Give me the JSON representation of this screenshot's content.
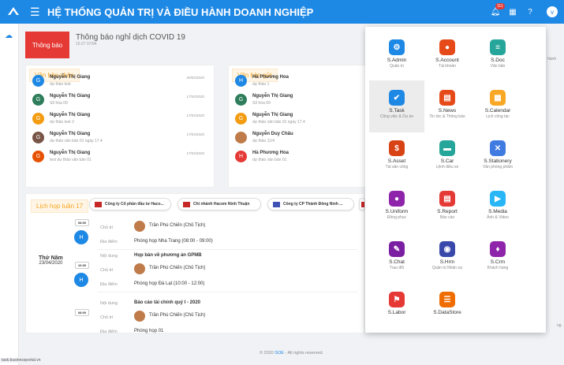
{
  "header": {
    "title": "HỆ THỐNG QUẢN TRỊ VÀ ĐIỀU HÀNH DOANH NGHIỆP",
    "notif_count": "111",
    "menu_icon": "hamburger-icon",
    "avatar_initial": "v",
    "brand_color": "#1e88e5"
  },
  "notification": {
    "label": "Thông báo",
    "title": "Thông báo nghỉ dịch COVID 19",
    "time": "16:27 07/04"
  },
  "received": {
    "title": "Văn bản nhận",
    "items": [
      {
        "initial": "G",
        "name": "Nguyễn Thị Giang",
        "sub": "dự thảo test",
        "date": "20/04/2020",
        "color": "#1e88e5"
      },
      {
        "initial": "G",
        "name": "Nguyễn Thị Giang",
        "sub": "Sổ hóa 09",
        "date": "17/04/2020",
        "color": "#2e7d5b"
      },
      {
        "initial": "G",
        "name": "Nguyễn Thị Giang",
        "sub": "dự thảo test 2",
        "date": "17/04/2020",
        "color": "#f39c12"
      },
      {
        "initial": "G",
        "name": "Nguyễn Thị Giang",
        "sub": "dự thảo văn bản 01 ngày 17.4",
        "date": "17/04/2020",
        "color": "#795548"
      },
      {
        "initial": "G",
        "name": "Nguyễn Thị Giang",
        "sub": "test dự thảo văn bản 01",
        "date": "17/04/2020",
        "color": "#e65100"
      }
    ]
  },
  "sent": {
    "title": "Văn bản gửi",
    "items": [
      {
        "initial": "H",
        "name": "Hà Phương Hoa",
        "sub": "dự thảo 1",
        "color": "#1e88e5",
        "photo": false
      },
      {
        "initial": "G",
        "name": "Nguyễn Thị Giang",
        "sub": "Sổ hóa 09",
        "color": "#2e7d5b",
        "photo": false
      },
      {
        "initial": "G",
        "name": "Nguyễn Thị Giang",
        "sub": "dự thảo văn bản 01 ngày 17.4",
        "color": "#f39c12",
        "photo": false
      },
      {
        "initial": "C",
        "name": "Nguyễn Duy Châu",
        "sub": "dự thảo 11/4",
        "color": "#bf7b4a",
        "photo": true
      },
      {
        "initial": "H",
        "name": "Hà Phương Hoa",
        "sub": "dự thảo văn bản 01",
        "color": "#e53935",
        "photo": false
      }
    ]
  },
  "calendar": {
    "title": "Lịch họp tuần 17",
    "orgs": [
      "Công ty Cổ phần đầu tư Haco...",
      "Chi nhánh Hacom Ninh Thuận",
      "Công ty CP Thành Đông Ninh ..."
    ],
    "day": "Thứ Năm",
    "date": "23/04/2020",
    "labels": {
      "content": "Nội dung",
      "chair": "Chủ trì",
      "place": "Địa điểm"
    },
    "meetings": [
      {
        "slot": "08:00",
        "initial": "H",
        "chair": "Trần Phú Chiến (Chủ Tịch)",
        "place": "Phòng họp Nha Trang (08:00 - 09:00)"
      },
      {
        "slot": "10:00",
        "initial": "H",
        "content": "Họp bàn về phương án GPMB",
        "chair": "Trần Phú Chiến (Chủ Tịch)",
        "place": "Phòng họp Đà Lạt (10:00 - 12:00)"
      },
      {
        "slot": "08:00",
        "initial": "",
        "content": "Báo cáo tài chính quý I - 2020",
        "chair": "Trần Phú Chiến (Chủ Tịch)",
        "place": "Phòng họp 01"
      }
    ]
  },
  "apps": [
    {
      "name": "S.Admin",
      "sub": "Quản trị",
      "icon": "admin-icon",
      "color": "#1e88e5",
      "glyph": "⚙"
    },
    {
      "name": "S.Account",
      "sub": "Tài khoản",
      "icon": "account-icon",
      "color": "#e64a19",
      "glyph": "●"
    },
    {
      "name": "S.Doc",
      "sub": "Văn bản",
      "icon": "doc-icon",
      "color": "#26a69a",
      "glyph": "≡"
    },
    {
      "name": "S.Task",
      "sub": "Công việc & Dự án",
      "icon": "task-icon",
      "color": "#1e88e5",
      "glyph": "✔"
    },
    {
      "name": "S.News",
      "sub": "Tin tức & Thông báo",
      "icon": "news-icon",
      "color": "#e64a19",
      "glyph": "▤"
    },
    {
      "name": "S.Calendar",
      "sub": "Lịch công tác",
      "icon": "calendar-icon",
      "color": "#f9a825",
      "glyph": "▦"
    },
    {
      "name": "S.Asset",
      "sub": "Tài sản công",
      "icon": "asset-icon",
      "color": "#d84315",
      "glyph": "$"
    },
    {
      "name": "S.Car",
      "sub": "Lệnh điều xe",
      "icon": "car-icon",
      "color": "#26a69a",
      "glyph": "▬"
    },
    {
      "name": "S.Stationery",
      "sub": "Văn phòng phẩm",
      "icon": "stationery-icon",
      "color": "#3f7be0",
      "glyph": "✕"
    },
    {
      "name": "S.Uniform",
      "sub": "Đồng phục",
      "icon": "uniform-icon",
      "color": "#8e24aa",
      "glyph": "●"
    },
    {
      "name": "S.Report",
      "sub": "Báo cáo",
      "icon": "report-icon",
      "color": "#e53935",
      "glyph": "▤"
    },
    {
      "name": "S.Media",
      "sub": "Ảnh & Video",
      "icon": "media-icon",
      "color": "#29b6f6",
      "glyph": "▶"
    },
    {
      "name": "S.Chat",
      "sub": "Trao đổi",
      "icon": "chat-icon",
      "color": "#7b1fa2",
      "glyph": "✎"
    },
    {
      "name": "S.Hrm",
      "sub": "Quản trị Nhân sự",
      "icon": "hrm-icon",
      "color": "#3949ab",
      "glyph": "◉"
    },
    {
      "name": "S.Crm",
      "sub": "Khách hàng",
      "icon": "crm-icon",
      "color": "#8e24aa",
      "glyph": "♦"
    },
    {
      "name": "S.Labor",
      "sub": "",
      "icon": "labor-icon",
      "color": "#e53935",
      "glyph": "⚑"
    },
    {
      "name": "S.DataStore",
      "sub": "",
      "icon": "datastore-icon",
      "color": "#ef6c00",
      "glyph": "☰"
    }
  ],
  "footer": {
    "text_prefix": "© 2020",
    "link": "SOE",
    "text_suffix": "- All rights reserved."
  },
  "status_url": "task.businessportal.vn",
  "bg_fragments": [
    "hành",
    "ng"
  ]
}
